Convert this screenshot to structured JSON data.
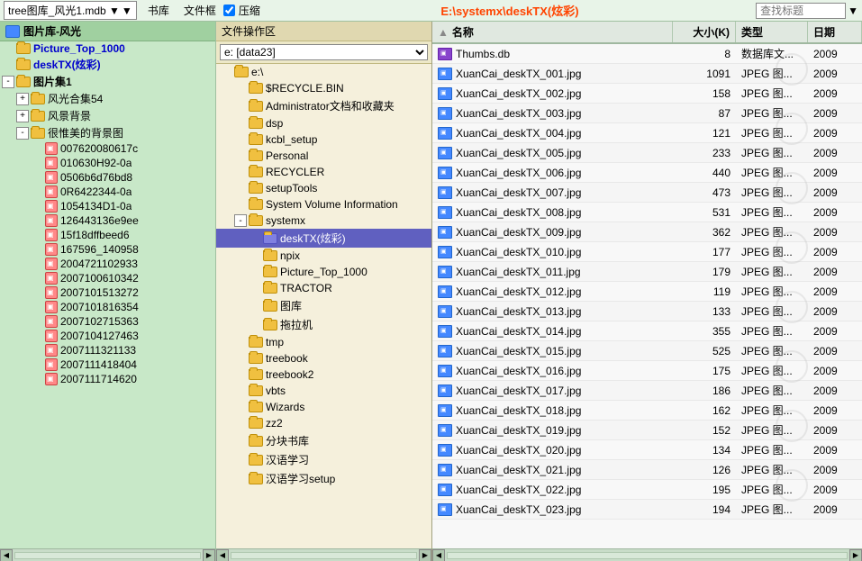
{
  "menubar": {
    "dropdown_label": "tree图库_风光1.mdb ▼",
    "menu_items": [
      "书库",
      "文件框",
      "压缩"
    ],
    "title": "E:\\systemx\\deskTX(炫彩)",
    "search_placeholder": "查找标题"
  },
  "left_panel": {
    "header": "图片库-风光",
    "items": [
      {
        "id": "pic_top",
        "label": "Picture_Top_1000",
        "indent": 0,
        "type": "folder",
        "style": "blue"
      },
      {
        "id": "desktx",
        "label": "deskTX(炫彩)",
        "indent": 0,
        "type": "folder",
        "style": "blue"
      },
      {
        "id": "jitu1",
        "label": "图片集1",
        "indent": 0,
        "type": "folder",
        "expanded": true,
        "style": "bold"
      },
      {
        "id": "guanghe54",
        "label": "风光合集54",
        "indent": 1,
        "type": "folder",
        "expander": "+"
      },
      {
        "id": "fengbg",
        "label": "风景背景",
        "indent": 1,
        "type": "folder",
        "expander": "+"
      },
      {
        "id": "henmei",
        "label": "很惟美的背景图",
        "indent": 1,
        "type": "folder",
        "expanded": true
      },
      {
        "id": "img1",
        "label": "007620080617c",
        "indent": 2,
        "type": "img"
      },
      {
        "id": "img2",
        "label": "010630H92-0a",
        "indent": 2,
        "type": "img"
      },
      {
        "id": "img3",
        "label": "0506b6d76bd8",
        "indent": 2,
        "type": "img"
      },
      {
        "id": "img4",
        "label": "0R6422344-0a",
        "indent": 2,
        "type": "img"
      },
      {
        "id": "img5",
        "label": "1054134D1-0a",
        "indent": 2,
        "type": "img"
      },
      {
        "id": "img6",
        "label": "126443136e9ee",
        "indent": 2,
        "type": "img"
      },
      {
        "id": "img7",
        "label": "15f18dffbeed6",
        "indent": 2,
        "type": "img"
      },
      {
        "id": "img8",
        "label": "167596_140958",
        "indent": 2,
        "type": "img"
      },
      {
        "id": "img9",
        "label": "2004721102933",
        "indent": 2,
        "type": "img"
      },
      {
        "id": "img10",
        "label": "2007100610342",
        "indent": 2,
        "type": "img"
      },
      {
        "id": "img11",
        "label": "2007101513272",
        "indent": 2,
        "type": "img"
      },
      {
        "id": "img12",
        "label": "2007101816354",
        "indent": 2,
        "type": "img"
      },
      {
        "id": "img13",
        "label": "2007102715363",
        "indent": 2,
        "type": "img"
      },
      {
        "id": "img14",
        "label": "2007104127463",
        "indent": 2,
        "type": "img"
      },
      {
        "id": "img15",
        "label": "2007111321133",
        "indent": 2,
        "type": "img"
      },
      {
        "id": "img16",
        "label": "2007111418404",
        "indent": 2,
        "type": "img"
      },
      {
        "id": "img17",
        "label": "2007111714620",
        "indent": 2,
        "type": "img"
      }
    ]
  },
  "middle_panel": {
    "header": "文件操作区",
    "drive": "e: [data23]",
    "items": [
      {
        "id": "root_e",
        "label": "e:\\",
        "indent": 0,
        "type": "folder_open"
      },
      {
        "id": "recycle",
        "label": "$RECYCLE.BIN",
        "indent": 1,
        "type": "folder"
      },
      {
        "id": "admin",
        "label": "Administrator文档和收藏夹",
        "indent": 1,
        "type": "folder"
      },
      {
        "id": "dsp",
        "label": "dsp",
        "indent": 1,
        "type": "folder"
      },
      {
        "id": "kcbl",
        "label": "kcbl_setup",
        "indent": 1,
        "type": "folder"
      },
      {
        "id": "personal",
        "label": "Personal",
        "indent": 1,
        "type": "folder"
      },
      {
        "id": "recycler",
        "label": "RECYCLER",
        "indent": 1,
        "type": "folder"
      },
      {
        "id": "setup",
        "label": "setupTools",
        "indent": 1,
        "type": "folder"
      },
      {
        "id": "sysvolinfo",
        "label": "System Volume Information",
        "indent": 1,
        "type": "folder"
      },
      {
        "id": "systemx",
        "label": "systemx",
        "indent": 1,
        "type": "folder_open",
        "expanded": true
      },
      {
        "id": "desktx_f",
        "label": "deskTX(炫彩)",
        "indent": 2,
        "type": "folder",
        "selected": true
      },
      {
        "id": "npix",
        "label": "npix",
        "indent": 2,
        "type": "folder"
      },
      {
        "id": "pic_top_f",
        "label": "Picture_Top_1000",
        "indent": 2,
        "type": "folder"
      },
      {
        "id": "tractor",
        "label": "TRACTOR",
        "indent": 2,
        "type": "folder"
      },
      {
        "id": "tuku",
        "label": "图库",
        "indent": 2,
        "type": "folder"
      },
      {
        "id": "tulaji",
        "label": "拖拉机",
        "indent": 2,
        "type": "folder"
      },
      {
        "id": "tmp",
        "label": "tmp",
        "indent": 1,
        "type": "folder"
      },
      {
        "id": "treebook",
        "label": "treebook",
        "indent": 1,
        "type": "folder"
      },
      {
        "id": "treebook2",
        "label": "treebook2",
        "indent": 1,
        "type": "folder"
      },
      {
        "id": "vbts",
        "label": "vbts",
        "indent": 1,
        "type": "folder"
      },
      {
        "id": "wizards",
        "label": "Wizards",
        "indent": 1,
        "type": "folder"
      },
      {
        "id": "zz2",
        "label": "zz2",
        "indent": 1,
        "type": "folder"
      },
      {
        "id": "fenkuai",
        "label": "分块书库",
        "indent": 1,
        "type": "folder"
      },
      {
        "id": "hanyu",
        "label": "汉语学习",
        "indent": 1,
        "type": "folder"
      },
      {
        "id": "hanyusetup",
        "label": "汉语学习setup",
        "indent": 1,
        "type": "folder"
      }
    ]
  },
  "right_panel": {
    "headers": [
      {
        "id": "name",
        "label": "名称"
      },
      {
        "id": "size",
        "label": "大小(K)"
      },
      {
        "id": "type",
        "label": "类型"
      },
      {
        "id": "date",
        "label": "日期"
      }
    ],
    "files": [
      {
        "name": "Thumbs.db",
        "size": "8",
        "type": "数据库文...",
        "date": "2009",
        "icon": "db"
      },
      {
        "name": "XuanCai_deskTX_001.jpg",
        "size": "1091",
        "type": "JPEG 图...",
        "date": "2009",
        "icon": "img"
      },
      {
        "name": "XuanCai_deskTX_002.jpg",
        "size": "158",
        "type": "JPEG 图...",
        "date": "2009",
        "icon": "img"
      },
      {
        "name": "XuanCai_deskTX_003.jpg",
        "size": "87",
        "type": "JPEG 图...",
        "date": "2009",
        "icon": "img"
      },
      {
        "name": "XuanCai_deskTX_004.jpg",
        "size": "121",
        "type": "JPEG 图...",
        "date": "2009",
        "icon": "img"
      },
      {
        "name": "XuanCai_deskTX_005.jpg",
        "size": "233",
        "type": "JPEG 图...",
        "date": "2009",
        "icon": "img"
      },
      {
        "name": "XuanCai_deskTX_006.jpg",
        "size": "440",
        "type": "JPEG 图...",
        "date": "2009",
        "icon": "img"
      },
      {
        "name": "XuanCai_deskTX_007.jpg",
        "size": "473",
        "type": "JPEG 图...",
        "date": "2009",
        "icon": "img"
      },
      {
        "name": "XuanCai_deskTX_008.jpg",
        "size": "531",
        "type": "JPEG 图...",
        "date": "2009",
        "icon": "img"
      },
      {
        "name": "XuanCai_deskTX_009.jpg",
        "size": "362",
        "type": "JPEG 图...",
        "date": "2009",
        "icon": "img"
      },
      {
        "name": "XuanCai_deskTX_010.jpg",
        "size": "177",
        "type": "JPEG 图...",
        "date": "2009",
        "icon": "img"
      },
      {
        "name": "XuanCai_deskTX_011.jpg",
        "size": "179",
        "type": "JPEG 图...",
        "date": "2009",
        "icon": "img"
      },
      {
        "name": "XuanCai_deskTX_012.jpg",
        "size": "119",
        "type": "JPEG 图...",
        "date": "2009",
        "icon": "img"
      },
      {
        "name": "XuanCai_deskTX_013.jpg",
        "size": "133",
        "type": "JPEG 图...",
        "date": "2009",
        "icon": "img"
      },
      {
        "name": "XuanCai_deskTX_014.jpg",
        "size": "355",
        "type": "JPEG 图...",
        "date": "2009",
        "icon": "img"
      },
      {
        "name": "XuanCai_deskTX_015.jpg",
        "size": "525",
        "type": "JPEG 图...",
        "date": "2009",
        "icon": "img"
      },
      {
        "name": "XuanCai_deskTX_016.jpg",
        "size": "175",
        "type": "JPEG 图...",
        "date": "2009",
        "icon": "img"
      },
      {
        "name": "XuanCai_deskTX_017.jpg",
        "size": "186",
        "type": "JPEG 图...",
        "date": "2009",
        "icon": "img"
      },
      {
        "name": "XuanCai_deskTX_018.jpg",
        "size": "162",
        "type": "JPEG 图...",
        "date": "2009",
        "icon": "img"
      },
      {
        "name": "XuanCai_deskTX_019.jpg",
        "size": "152",
        "type": "JPEG 图...",
        "date": "2009",
        "icon": "img"
      },
      {
        "name": "XuanCai_deskTX_020.jpg",
        "size": "134",
        "type": "JPEG 图...",
        "date": "2009",
        "icon": "img"
      },
      {
        "name": "XuanCai_deskTX_021.jpg",
        "size": "126",
        "type": "JPEG 图...",
        "date": "2009",
        "icon": "img"
      },
      {
        "name": "XuanCai_deskTX_022.jpg",
        "size": "195",
        "type": "JPEG 图...",
        "date": "2009",
        "icon": "img"
      },
      {
        "name": "XuanCai_deskTX_023.jpg",
        "size": "194",
        "type": "JPEG 图...",
        "date": "2009",
        "icon": "img"
      }
    ]
  }
}
